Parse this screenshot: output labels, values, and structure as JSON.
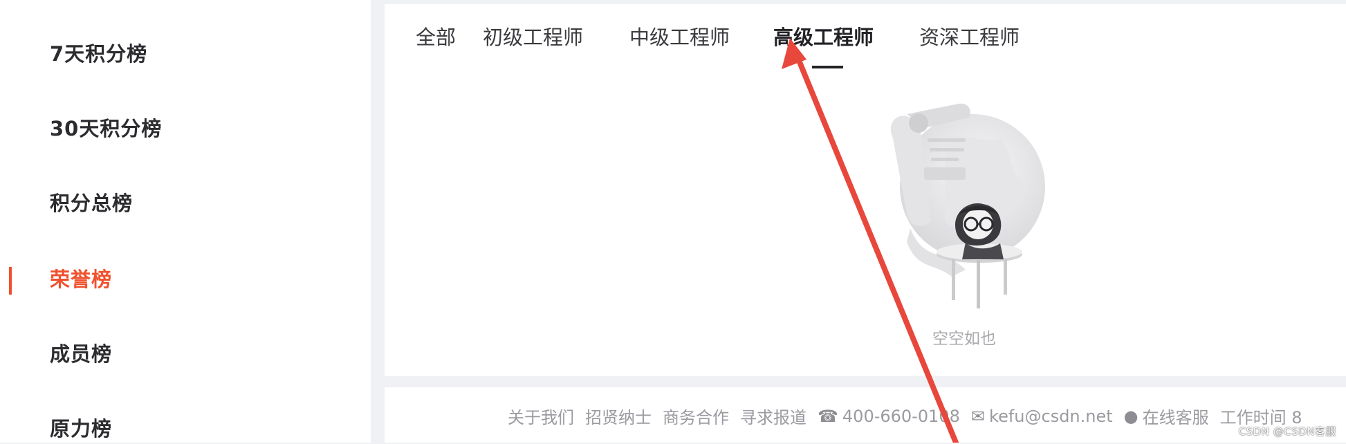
{
  "sidebar": {
    "items": [
      {
        "label": "7天积分榜"
      },
      {
        "label": "30天积分榜"
      },
      {
        "label": "积分总榜"
      },
      {
        "label": "荣誉榜",
        "active": true
      },
      {
        "label": "成员榜"
      },
      {
        "label": "原力榜"
      }
    ]
  },
  "tabs": [
    {
      "label": "全部"
    },
    {
      "label": "初级工程师"
    },
    {
      "label": "中级工程师"
    },
    {
      "label": "高级工程师",
      "active": true
    },
    {
      "label": "资深工程师"
    }
  ],
  "empty_state": {
    "text": "空空如也"
  },
  "footer": {
    "about": "关于我们",
    "careers": "招贤纳士",
    "business": "商务合作",
    "press": "寻求报道",
    "phone": "400-660-0108",
    "email": "kefu@csdn.net",
    "online_service": "在线客服",
    "work_hours": "工作时间 8"
  },
  "watermark": "CSDN @CSDN客服",
  "colors": {
    "accent": "#f0512d",
    "annotation_arrow": "#e8473c"
  }
}
